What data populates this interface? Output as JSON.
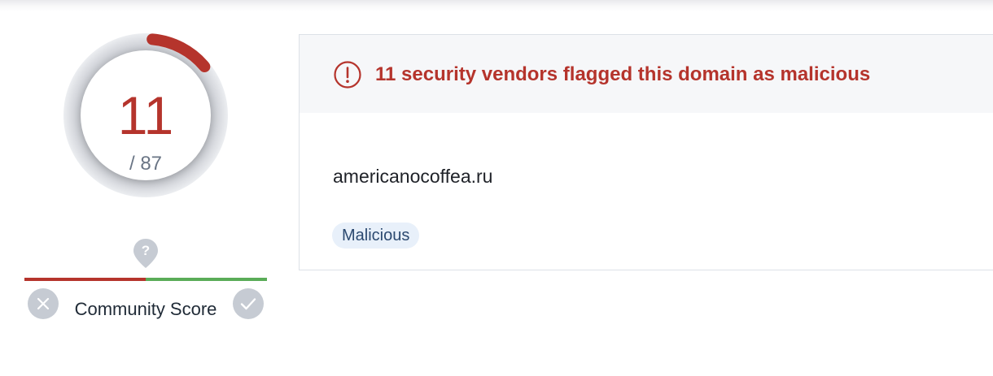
{
  "detection": {
    "malicious_count": "11",
    "total_label": "/ 87",
    "ratio": 0.126,
    "colors": {
      "accent": "#b5342c",
      "ring": "#dcdee3",
      "muted": "#6a7585"
    }
  },
  "community": {
    "marker_icon": "question-marker-icon",
    "label": "Community Score",
    "downvote_icon": "x-icon",
    "upvote_icon": "check-icon",
    "colors": {
      "negative": "#b5342c",
      "positive": "#5aac58",
      "button": "#c6cbd3"
    }
  },
  "summary": {
    "alert_icon": "exclamation-circle-icon",
    "alert_text": "11 security vendors flagged this domain as malicious",
    "domain": "americanocoffea.ru",
    "tags": [
      "Malicious"
    ]
  }
}
